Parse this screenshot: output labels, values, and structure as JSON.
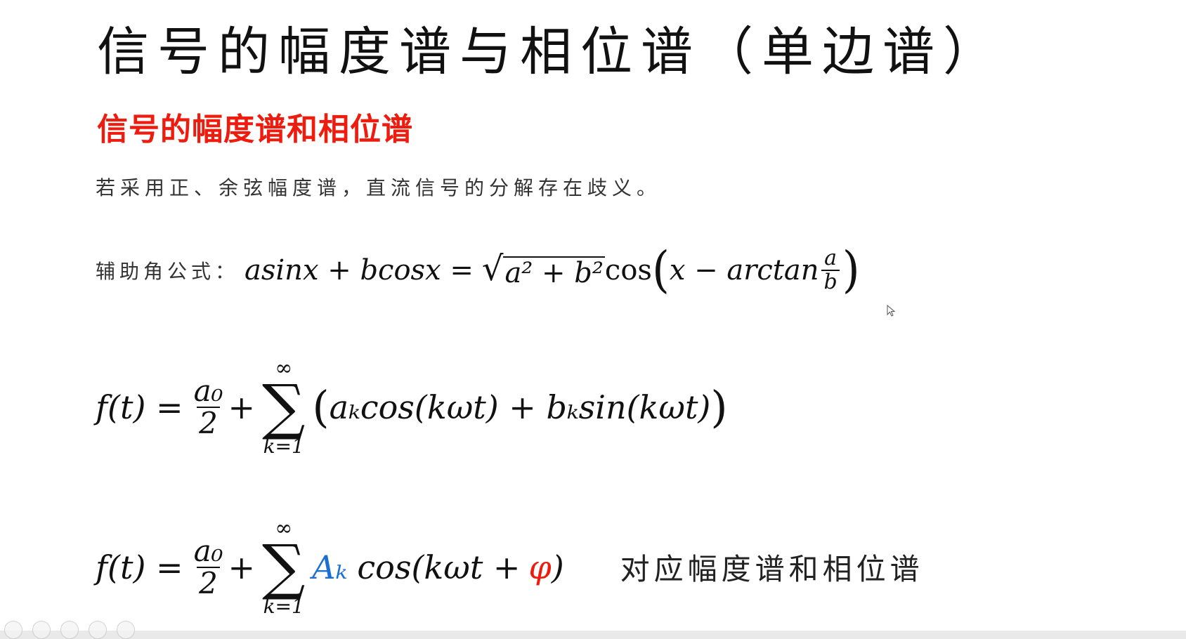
{
  "slide": {
    "title": "信号的幅度谱与相位谱（单边谱）",
    "subtitle": "信号的幅度谱和相位谱",
    "note": "若采用正、余弦幅度谱，直流信号的分解存在歧义。",
    "aux_label": "辅助角公式：",
    "aux_formula": {
      "lhs": "asinx + bcosx =",
      "sqrt_content": "a² + b²",
      "cos": "cos",
      "inner": "x − arctan",
      "frac_num": "a",
      "frac_den": "b"
    },
    "eq1": {
      "lhs": "f(t) =",
      "frac_num": "a₀",
      "frac_den": "2",
      "plus": "+",
      "sum_top": "∞",
      "sum_symbol": "∑",
      "sum_bottom": "k=1",
      "body": "aₖcos(kωt) + bₖsin(kωt)"
    },
    "eq2": {
      "lhs": "f(t) =",
      "frac_num": "a₀",
      "frac_den": "2",
      "plus": "+",
      "sum_top": "∞",
      "sum_symbol": "∑",
      "sum_bottom": "k=1",
      "amp": "Aₖ",
      "cos_open": "cos(kωt +",
      "phase": "φ",
      "close": ")",
      "meaning": "对应幅度谱和相位谱"
    }
  },
  "colors": {
    "subtitle": "#ee1c0e",
    "amplitude": "#1b6fd1",
    "phase": "#ee1c0e"
  },
  "icons": [
    "mouse-cursor-icon"
  ]
}
